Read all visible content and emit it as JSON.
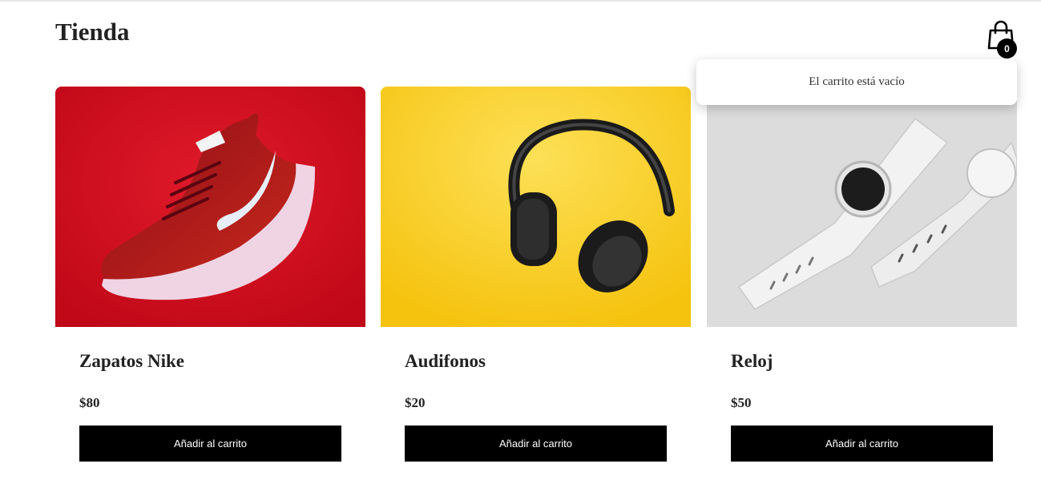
{
  "header": {
    "title": "Tienda"
  },
  "cart": {
    "count": "0",
    "empty_message": "El carrito está vacío"
  },
  "products": [
    {
      "name": "Zapatos Nike",
      "price": "$80",
      "button_label": "Añadir al carrito",
      "image_icon": "red-sneaker"
    },
    {
      "name": "Audifonos",
      "price": "$20",
      "button_label": "Añadir al carrito",
      "image_icon": "black-headphones"
    },
    {
      "name": "Reloj",
      "price": "$50",
      "button_label": "Añadir al carrito",
      "image_icon": "white-smartwatch"
    }
  ],
  "colors": {
    "button_bg": "#000000",
    "sneaker_bg": "#d1101f",
    "headphones_bg": "#f7c920",
    "watch_bg": "#dddddd"
  }
}
